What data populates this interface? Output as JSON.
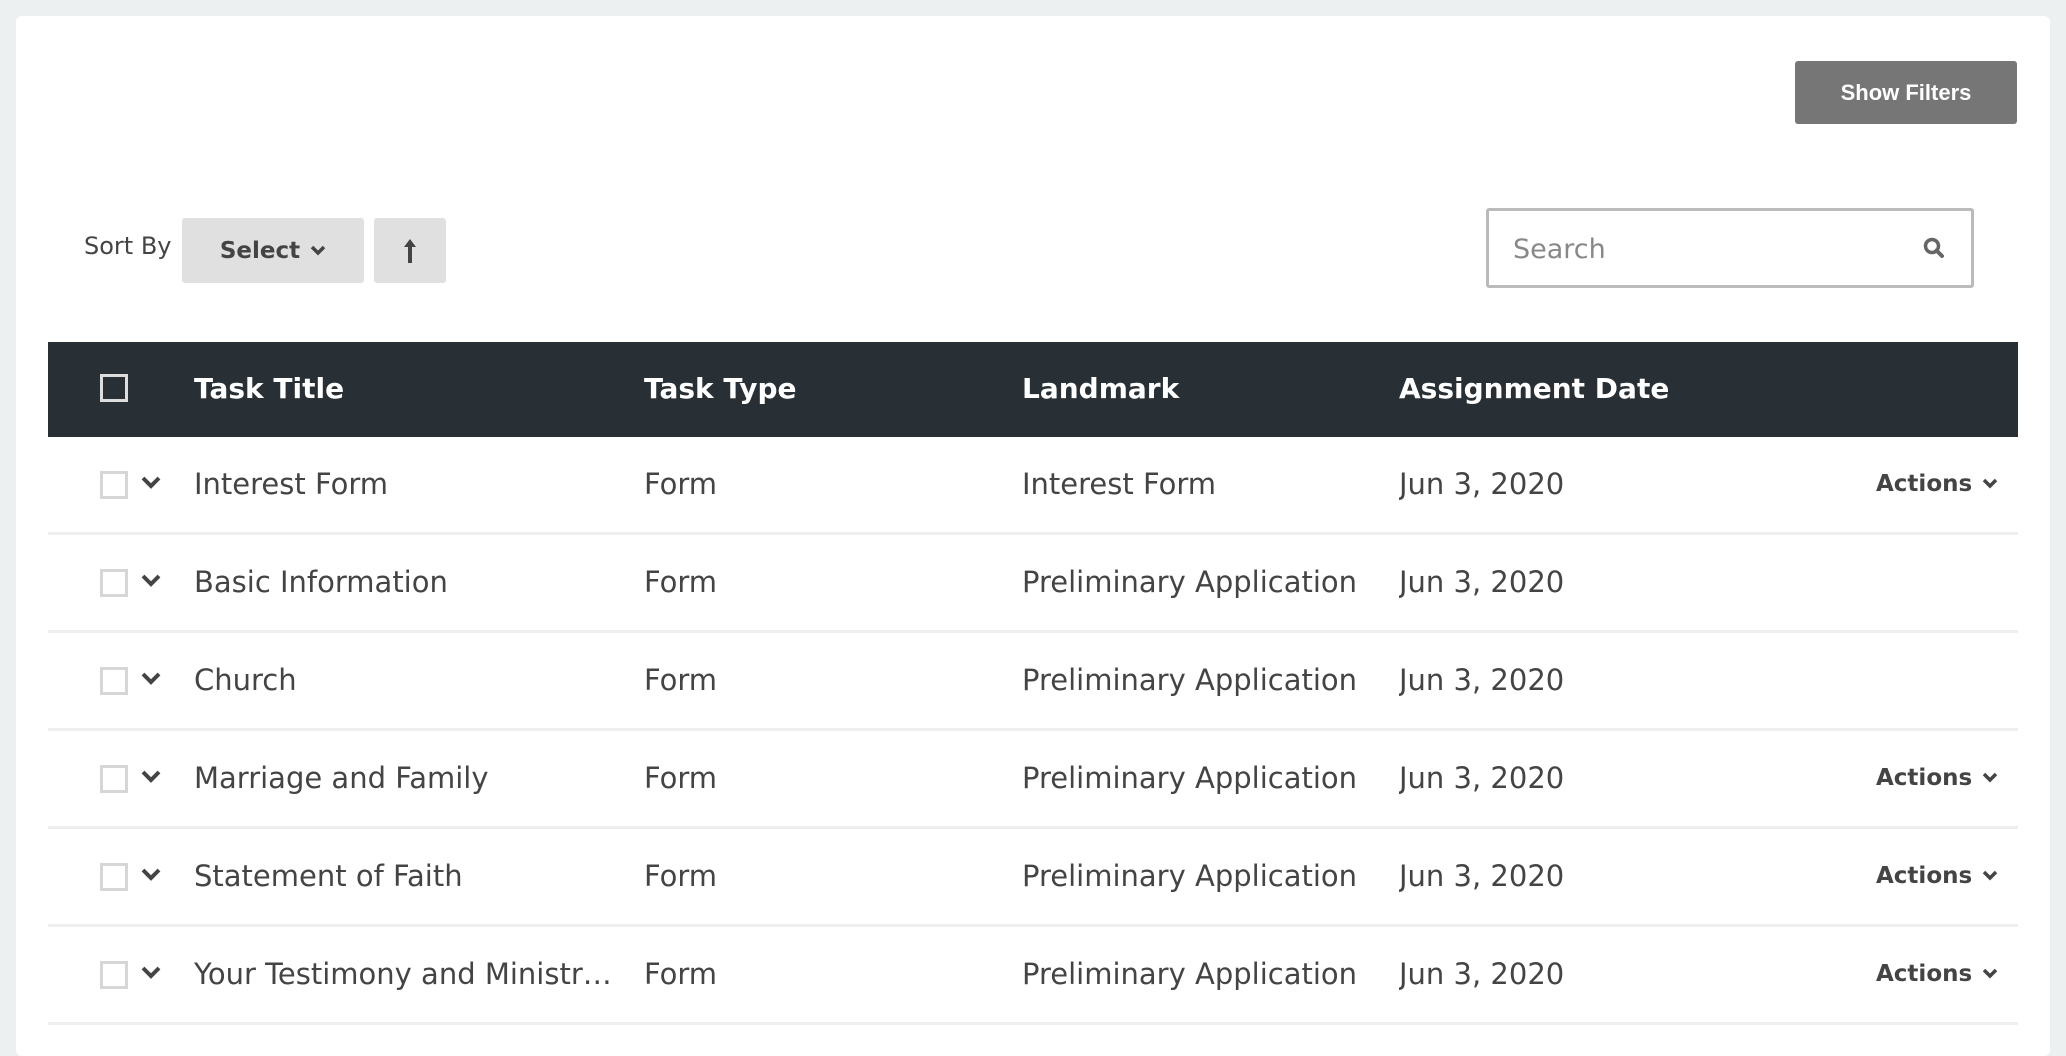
{
  "toolbar": {
    "show_filters_label": "Show Filters",
    "sort_by_label": "Sort By",
    "sort_select_label": "Select",
    "sort_direction_icon": "arrow-up-icon",
    "search_placeholder": "Search",
    "search_value": ""
  },
  "table": {
    "columns": [
      "Task Title",
      "Task Type",
      "Landmark",
      "Assignment Date"
    ],
    "rows": [
      {
        "title": "Interest Form",
        "type": "Form",
        "landmark": "Interest Form",
        "date": "Jun 3, 2020",
        "actions": "Actions"
      },
      {
        "title": "Basic Information",
        "type": "Form",
        "landmark": "Preliminary Application",
        "date": "Jun 3, 2020",
        "actions": ""
      },
      {
        "title": "Church",
        "type": "Form",
        "landmark": "Preliminary Application",
        "date": "Jun 3, 2020",
        "actions": ""
      },
      {
        "title": "Marriage and Family",
        "type": "Form",
        "landmark": "Preliminary Application",
        "date": "Jun 3, 2020",
        "actions": "Actions"
      },
      {
        "title": "Statement of Faith",
        "type": "Form",
        "landmark": "Preliminary Application",
        "date": "Jun 3, 2020",
        "actions": "Actions"
      },
      {
        "title": "Your Testimony and Ministry ...",
        "type": "Form",
        "landmark": "Preliminary Application",
        "date": "Jun 3, 2020",
        "actions": "Actions"
      }
    ]
  },
  "colors": {
    "page_bg": "#ecf0f1",
    "header_bg": "#283035",
    "filters_button": "#767676",
    "sort_button": "#e0e0e0"
  }
}
